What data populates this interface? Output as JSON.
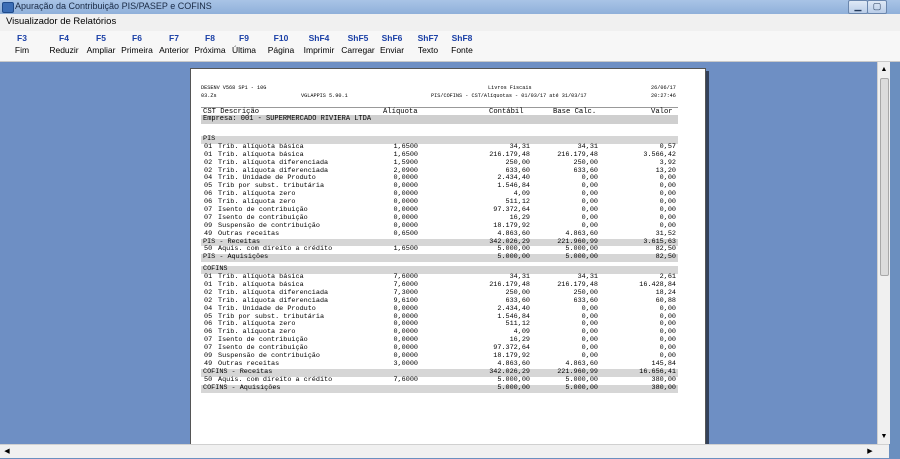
{
  "window": {
    "title": "Apuração da Contribuição PIS/PASEP e COFINS",
    "minimize": "▁",
    "maximize": "▢",
    "close": "✕"
  },
  "viewer_title": "Visualizador de Relatórios",
  "toolbar": [
    {
      "key": "F3",
      "label": "Fim"
    },
    {
      "key": "F4",
      "label": "Reduzir"
    },
    {
      "key": "F5",
      "label": "Ampliar"
    },
    {
      "key": "F6",
      "label": "Primeira"
    },
    {
      "key": "F7",
      "label": "Anterior"
    },
    {
      "key": "F8",
      "label": "Próxima"
    },
    {
      "key": "F9",
      "label": "Última"
    },
    {
      "key": "F10",
      "label": "Página"
    },
    {
      "key": "ShF4",
      "label": "Imprimir"
    },
    {
      "key": "ShF5",
      "label": "Carregar"
    },
    {
      "key": "ShF6",
      "label": "Enviar"
    },
    {
      "key": "ShF7",
      "label": "Texto"
    },
    {
      "key": "ShF8",
      "label": "Fonte"
    }
  ],
  "report": {
    "header": {
      "system": "DESENV V568 SP1 - 10G",
      "report_title": "Livros Fiscais",
      "date": "26/06/17",
      "code": "03.Zs",
      "program": "VGLAPPIS 5.90.1",
      "subtitle": "PIS/COFINS - CST/Alíquotas - 01/03/17 até 31/03/17",
      "time": "20:27:46"
    },
    "columns": {
      "cst_desc": "CST Descrição",
      "aliquota": "Alíquota",
      "contabil": "Contábil",
      "base_calc": "Base Calc.",
      "valor": "Valor"
    },
    "empresa": "Empresa: 001 - SUPERMERCADO RIVIERA LTDA",
    "rows": [
      {
        "t": "gap"
      },
      {
        "t": "sec",
        "text": "PIS"
      },
      {
        "t": "d",
        "cst": "01",
        "desc": "Trib. alíquota básica",
        "ali": "1,6500",
        "cont": "34,31",
        "base": "34,31",
        "val": "0,57"
      },
      {
        "t": "d",
        "cst": "01",
        "desc": "Trib. alíquota básica",
        "ali": "1,6500",
        "cont": "216.179,48",
        "base": "216.179,48",
        "val": "3.566,42"
      },
      {
        "t": "d",
        "cst": "02",
        "desc": "Trib. alíquota diferenciada",
        "ali": "1,5900",
        "cont": "250,00",
        "base": "250,00",
        "val": "3,92"
      },
      {
        "t": "d",
        "cst": "02",
        "desc": "Trib. alíquota diferenciada",
        "ali": "2,0900",
        "cont": "633,60",
        "base": "633,60",
        "val": "13,20"
      },
      {
        "t": "d",
        "cst": "04",
        "desc": "Trib. Unidade de Produto",
        "ali": "0,0000",
        "cont": "2.434,40",
        "base": "0,00",
        "val": "0,00"
      },
      {
        "t": "d",
        "cst": "05",
        "desc": "Trib por subst. tributária",
        "ali": "0,0000",
        "cont": "1.546,84",
        "base": "0,00",
        "val": "0,00"
      },
      {
        "t": "d",
        "cst": "06",
        "desc": "Trib. alíquota zero",
        "ali": "0,0000",
        "cont": "4,09",
        "base": "0,00",
        "val": "0,00"
      },
      {
        "t": "d",
        "cst": "06",
        "desc": "Trib. alíquota zero",
        "ali": "0,0000",
        "cont": "511,12",
        "base": "0,00",
        "val": "0,00"
      },
      {
        "t": "d",
        "cst": "07",
        "desc": "Isento de contribuição",
        "ali": "0,0000",
        "cont": "97.372,64",
        "base": "0,00",
        "val": "0,00"
      },
      {
        "t": "d",
        "cst": "07",
        "desc": "Isento de contribuição",
        "ali": "0,0000",
        "cont": "16,29",
        "base": "0,00",
        "val": "0,00"
      },
      {
        "t": "d",
        "cst": "09",
        "desc": "Suspensão de contribuição",
        "ali": "0,0000",
        "cont": "18.179,92",
        "base": "0,00",
        "val": "0,00"
      },
      {
        "t": "d",
        "cst": "49",
        "desc": "Outras receitas",
        "ali": "0,6500",
        "cont": "4.863,60",
        "base": "4.863,60",
        "val": "31,52"
      },
      {
        "t": "tot",
        "text": "PIS - Receitas",
        "cont": "342.026,29",
        "base": "221.960,99",
        "val": "3.615,63"
      },
      {
        "t": "d",
        "cst": "50",
        "desc": "Aquis. com direito a crédito",
        "ali": "1,6500",
        "cont": "5.000,00",
        "base": "5.000,00",
        "val": "82,50"
      },
      {
        "t": "tot",
        "text": "PIS - Aquisições",
        "cont": "5.000,00",
        "base": "5.000,00",
        "val": "82,50"
      },
      {
        "t": "gap"
      },
      {
        "t": "sec",
        "text": "COFINS"
      },
      {
        "t": "d",
        "cst": "01",
        "desc": "Trib. alíquota básica",
        "ali": "7,6000",
        "cont": "34,31",
        "base": "34,31",
        "val": "2,61"
      },
      {
        "t": "d",
        "cst": "01",
        "desc": "Trib. alíquota básica",
        "ali": "7,6000",
        "cont": "216.179,48",
        "base": "216.179,48",
        "val": "16.428,84"
      },
      {
        "t": "d",
        "cst": "02",
        "desc": "Trib. alíquota diferenciada",
        "ali": "7,3000",
        "cont": "250,00",
        "base": "250,00",
        "val": "18,24"
      },
      {
        "t": "d",
        "cst": "02",
        "desc": "Trib. alíquota diferenciada",
        "ali": "9,6100",
        "cont": "633,60",
        "base": "633,60",
        "val": "60,88"
      },
      {
        "t": "d",
        "cst": "04",
        "desc": "Trib. Unidade de Produto",
        "ali": "0,0000",
        "cont": "2.434,40",
        "base": "0,00",
        "val": "0,00"
      },
      {
        "t": "d",
        "cst": "05",
        "desc": "Trib por subst. tributária",
        "ali": "0,0000",
        "cont": "1.546,84",
        "base": "0,00",
        "val": "0,00"
      },
      {
        "t": "d",
        "cst": "06",
        "desc": "Trib. alíquota zero",
        "ali": "0,0000",
        "cont": "511,12",
        "base": "0,00",
        "val": "0,00"
      },
      {
        "t": "d",
        "cst": "06",
        "desc": "Trib. alíquota zero",
        "ali": "0,0000",
        "cont": "4,09",
        "base": "0,00",
        "val": "0,00"
      },
      {
        "t": "d",
        "cst": "07",
        "desc": "Isento de contribuição",
        "ali": "0,0000",
        "cont": "16,29",
        "base": "0,00",
        "val": "0,00"
      },
      {
        "t": "d",
        "cst": "07",
        "desc": "Isento de contribuição",
        "ali": "0,0000",
        "cont": "97.372,64",
        "base": "0,00",
        "val": "0,00"
      },
      {
        "t": "d",
        "cst": "09",
        "desc": "Suspensão de contribuição",
        "ali": "0,0000",
        "cont": "18.179,92",
        "base": "0,00",
        "val": "0,00"
      },
      {
        "t": "d",
        "cst": "49",
        "desc": "Outras receitas",
        "ali": "3,0000",
        "cont": "4.863,60",
        "base": "4.863,60",
        "val": "145,84"
      },
      {
        "t": "tot",
        "text": "COFINS - Receitas",
        "cont": "342.026,29",
        "base": "221.960,99",
        "val": "16.656,41"
      },
      {
        "t": "d",
        "cst": "50",
        "desc": "Aquis. com direito a crédito",
        "ali": "7,6000",
        "cont": "5.000,00",
        "base": "5.000,00",
        "val": "380,00"
      },
      {
        "t": "tot",
        "text": "COFINS - Aquisições",
        "cont": "5.000,00",
        "base": "5.000,00",
        "val": "380,00"
      }
    ]
  }
}
